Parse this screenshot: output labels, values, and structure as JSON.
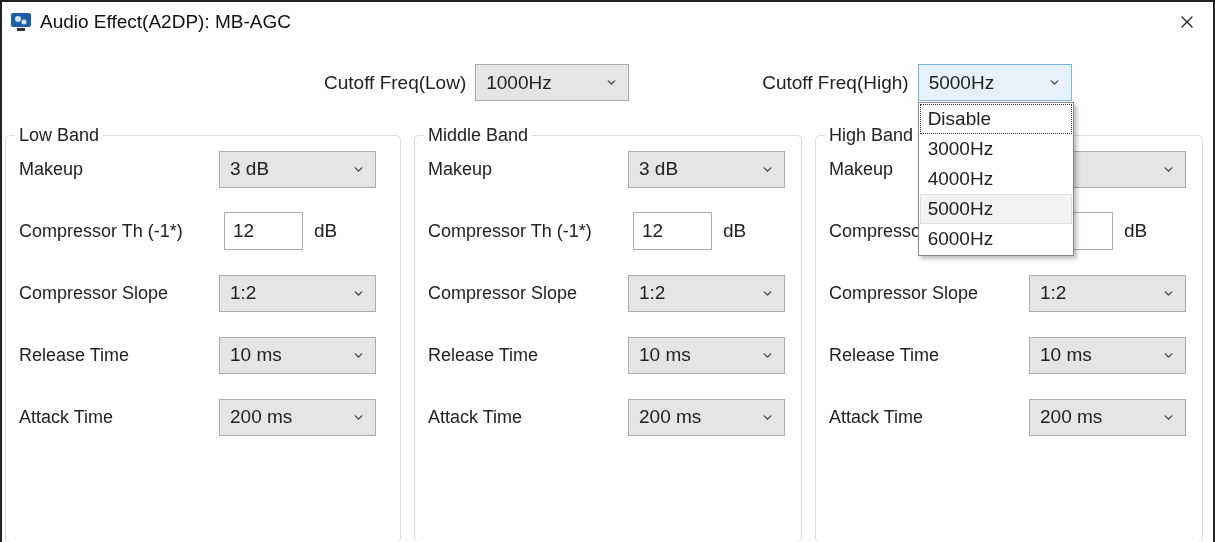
{
  "window": {
    "title": "Audio Effect(A2DP): MB-AGC"
  },
  "cutoff": [
    {
      "label": "Cutoff Freq(Low)",
      "value": "1000Hz",
      "open": false
    },
    {
      "label": "Cutoff Freq(High)",
      "value": "5000Hz",
      "open": true,
      "options": [
        {
          "label": "Disable",
          "focused": true,
          "selected": false
        },
        {
          "label": "3000Hz",
          "focused": false,
          "selected": false
        },
        {
          "label": "4000Hz",
          "focused": false,
          "selected": false
        },
        {
          "label": "5000Hz",
          "focused": false,
          "selected": true
        },
        {
          "label": "6000Hz",
          "focused": false,
          "selected": false
        }
      ]
    }
  ],
  "bands": [
    {
      "title": "Low Band",
      "rows": [
        {
          "kind": "select",
          "label": "Makeup",
          "value": "3 dB"
        },
        {
          "kind": "input",
          "label": "Compressor Th (-1*)",
          "value": "12",
          "unit": "dB"
        },
        {
          "kind": "select",
          "label": "Compressor Slope",
          "value": "1:2"
        },
        {
          "kind": "select",
          "label": "Release Time",
          "value": "10 ms"
        },
        {
          "kind": "select",
          "label": "Attack Time",
          "value": "200 ms"
        }
      ]
    },
    {
      "title": "Middle Band",
      "rows": [
        {
          "kind": "select",
          "label": "Makeup",
          "value": "3 dB"
        },
        {
          "kind": "input",
          "label": "Compressor Th (-1*)",
          "value": "12",
          "unit": "dB"
        },
        {
          "kind": "select",
          "label": "Compressor Slope",
          "value": "1:2"
        },
        {
          "kind": "select",
          "label": "Release Time",
          "value": "10 ms"
        },
        {
          "kind": "select",
          "label": "Attack Time",
          "value": "200 ms"
        }
      ]
    },
    {
      "title": "High Band",
      "rows": [
        {
          "kind": "select",
          "label": "Makeup"
        },
        {
          "kind": "input",
          "label": "Compresso",
          "unit": "dB"
        },
        {
          "kind": "select",
          "label": "Compressor Slope",
          "value": "1:2"
        },
        {
          "kind": "select",
          "label": "Release Time",
          "value": "10 ms"
        },
        {
          "kind": "select",
          "label": "Attack Time",
          "value": "200 ms"
        }
      ]
    }
  ]
}
